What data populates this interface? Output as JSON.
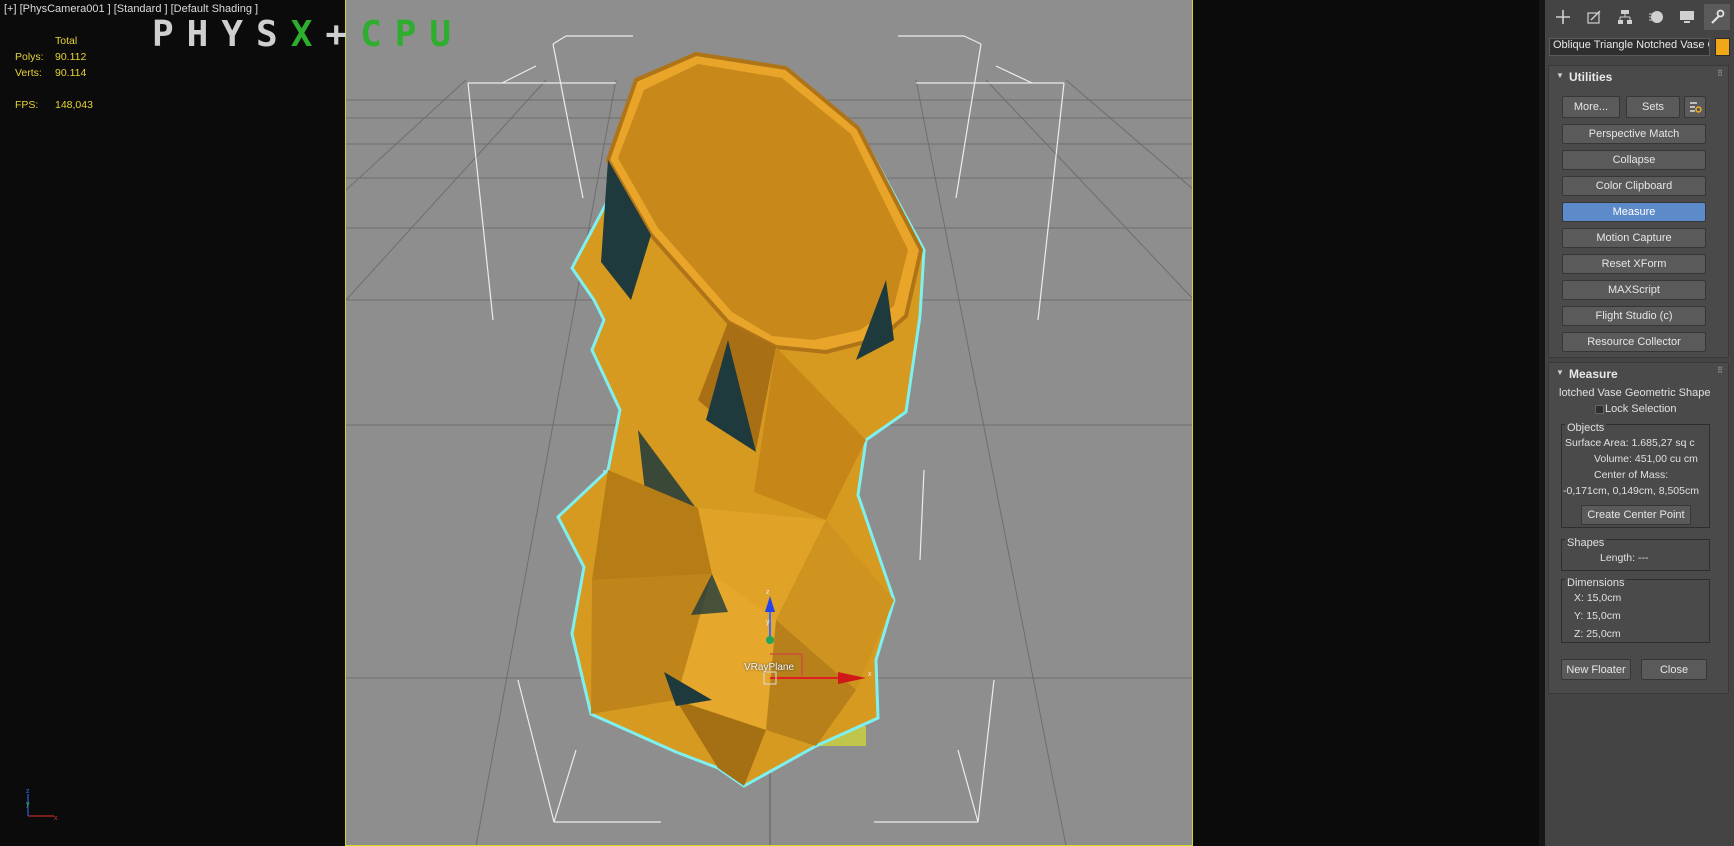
{
  "viewport": {
    "label": "[+] [PhysCamera001 ] [Standard ] [Default Shading ]",
    "stats": {
      "header": "Total",
      "polys_label": "Polys:",
      "polys_value": "90.112",
      "verts_label": "Verts:",
      "verts_value": "90.114",
      "fps_label": "FPS:",
      "fps_value": "148,043"
    },
    "physx_logo": {
      "part1": "PHYS",
      "part2": "X",
      "part3": "+",
      "part4": "CPU"
    },
    "object_label": "VRayPlane",
    "object_color": "#e6a020",
    "selection_outline_color": "#7ef0f0",
    "safe_frame_color": "#d6d61a",
    "gizmo_axes": [
      "z",
      "y",
      "x"
    ],
    "corner_axes": [
      "z",
      "y",
      "x"
    ]
  },
  "command_panel": {
    "tabs": [
      {
        "name": "create-tab",
        "icon": "plus-icon"
      },
      {
        "name": "modify-tab",
        "icon": "modify-icon"
      },
      {
        "name": "hierarchy-tab",
        "icon": "hierarchy-icon"
      },
      {
        "name": "motion-tab",
        "icon": "motion-icon"
      },
      {
        "name": "display-tab",
        "icon": "display-icon"
      },
      {
        "name": "utilities-tab",
        "icon": "wrench-icon",
        "active": true
      }
    ],
    "object_name": "Oblique Triangle Notched Vase Geometric Shape",
    "object_swatch_color": "#f0a818",
    "utilities": {
      "title": "Utilities",
      "more_label": "More...",
      "sets_label": "Sets",
      "buttons": [
        {
          "label": "Perspective Match",
          "active": false
        },
        {
          "label": "Collapse",
          "active": false
        },
        {
          "label": "Color Clipboard",
          "active": false
        },
        {
          "label": "Measure",
          "active": true
        },
        {
          "label": "Motion Capture",
          "active": false
        },
        {
          "label": "Reset XForm",
          "active": false
        },
        {
          "label": "MAXScript",
          "active": false
        },
        {
          "label": "Flight Studio (c)",
          "active": false
        },
        {
          "label": "Resource Collector",
          "active": false
        }
      ]
    },
    "measure": {
      "title": "Measure",
      "object_name": "lotched Vase Geometric Shape",
      "lock_label": "Lock Selection",
      "objects_group": "Objects",
      "surface_area": "Surface Area:  1.685,27 sq c",
      "volume": "Volume:  451,00 cu cm",
      "center_label": "Center of Mass:",
      "center_value": "-0,171cm, 0,149cm, 8,505cm",
      "create_center_label": "Create Center Point",
      "shapes_group": "Shapes",
      "length": "Length:  ---",
      "dimensions_group": "Dimensions",
      "dim_x": "X:   15,0cm",
      "dim_y": "Y:   15,0cm",
      "dim_z": "Z:   25,0cm",
      "new_floater_label": "New Floater",
      "close_label": "Close"
    }
  }
}
